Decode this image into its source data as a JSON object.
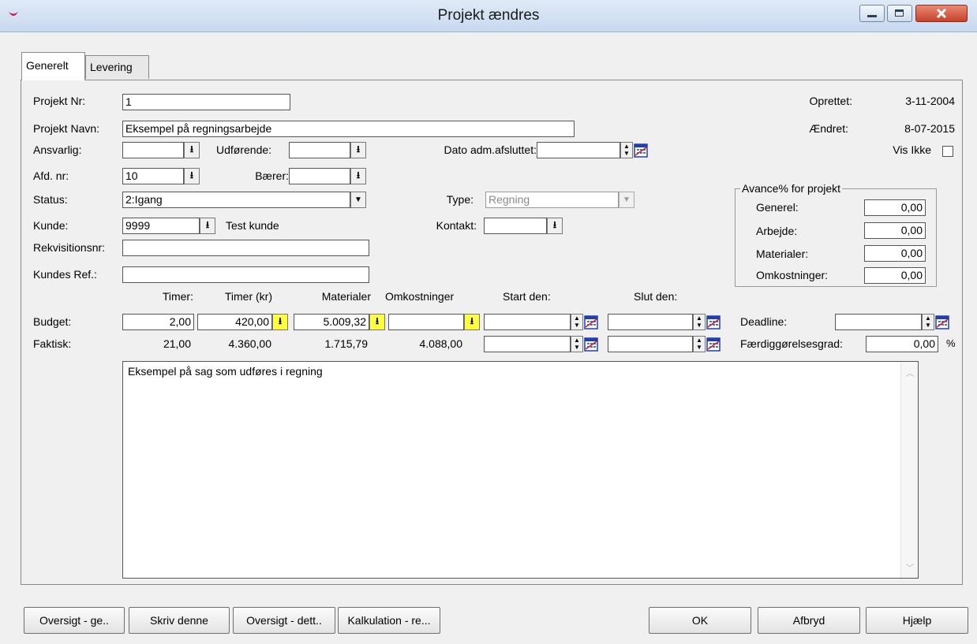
{
  "window": {
    "title": "Projekt ændres"
  },
  "tabs": [
    {
      "label": "Generelt"
    },
    {
      "label": "Levering"
    }
  ],
  "form": {
    "projekt_nr": {
      "label": "Projekt Nr:",
      "value": "1"
    },
    "projekt_navn": {
      "label": "Projekt Navn:",
      "value": "Eksempel på regningsarbejde"
    },
    "ansvarlig": {
      "label": "Ansvarlig:",
      "value": ""
    },
    "udforende": {
      "label": "Udførende:",
      "value": ""
    },
    "dato_adm": {
      "label": "Dato adm.afsluttet:",
      "value": ""
    },
    "afd_nr": {
      "label": "Afd. nr:",
      "value": "10"
    },
    "baerer": {
      "label": "Bærer:",
      "value": ""
    },
    "status": {
      "label": "Status:",
      "value": "2:Igang"
    },
    "type": {
      "label": "Type:",
      "value": "Regning"
    },
    "kunde": {
      "label": "Kunde:",
      "value": "9999",
      "name": "Test kunde"
    },
    "kontakt": {
      "label": "Kontakt:",
      "value": ""
    },
    "rekvisitionsnr": {
      "label": "Rekvisitionsnr:",
      "value": ""
    },
    "kundes_ref": {
      "label": "Kundes Ref.:",
      "value": ""
    },
    "oprettet": {
      "label": "Oprettet:",
      "value": "3-11-2004"
    },
    "aendret": {
      "label": "Ændret:",
      "value": "8-07-2015"
    },
    "vis_ikke": {
      "label": "Vis Ikke",
      "checked": false
    }
  },
  "avance": {
    "title": "Avance% for projekt",
    "rows": [
      {
        "label": "Generel:",
        "value": "0,00"
      },
      {
        "label": "Arbejde:",
        "value": "0,00"
      },
      {
        "label": "Materialer:",
        "value": "0,00"
      },
      {
        "label": "Omkostninger:",
        "value": "0,00"
      }
    ]
  },
  "grid": {
    "headers": [
      "Timer:",
      "Timer (kr)",
      "Materialer",
      "Omkostninger",
      "Start den:",
      "Slut den:"
    ],
    "budget": {
      "label": "Budget:",
      "timer": "2,00",
      "timer_kr": "420,00",
      "materialer": "5.009,32",
      "omkostninger": "",
      "start": "",
      "slut": ""
    },
    "faktisk": {
      "label": "Faktisk:",
      "timer": "21,00",
      "timer_kr": "4.360,00",
      "materialer": "1.715,79",
      "omkostninger": "4.088,00",
      "start": "",
      "slut": ""
    },
    "deadline": {
      "label": "Deadline:",
      "value": ""
    },
    "faerdig": {
      "label": "Færdiggørelsesgrad:",
      "value": "0,00",
      "unit": "%"
    }
  },
  "memo": {
    "text": "Eksempel på sag som udføres i regning"
  },
  "buttons": {
    "oversigt_ge": "Oversigt - ge..",
    "skriv_denne": "Skriv denne",
    "oversigt_dett": "Oversigt - dett..",
    "kalkulation": "Kalkulation - re...",
    "ok": "OK",
    "afbryd": "Afbryd",
    "hjaelp": "Hjælp"
  },
  "colors": {
    "highlight_yellow": "#ffff40",
    "close_button": "#c7412a",
    "calendar_blue": "#1f3fb0"
  }
}
